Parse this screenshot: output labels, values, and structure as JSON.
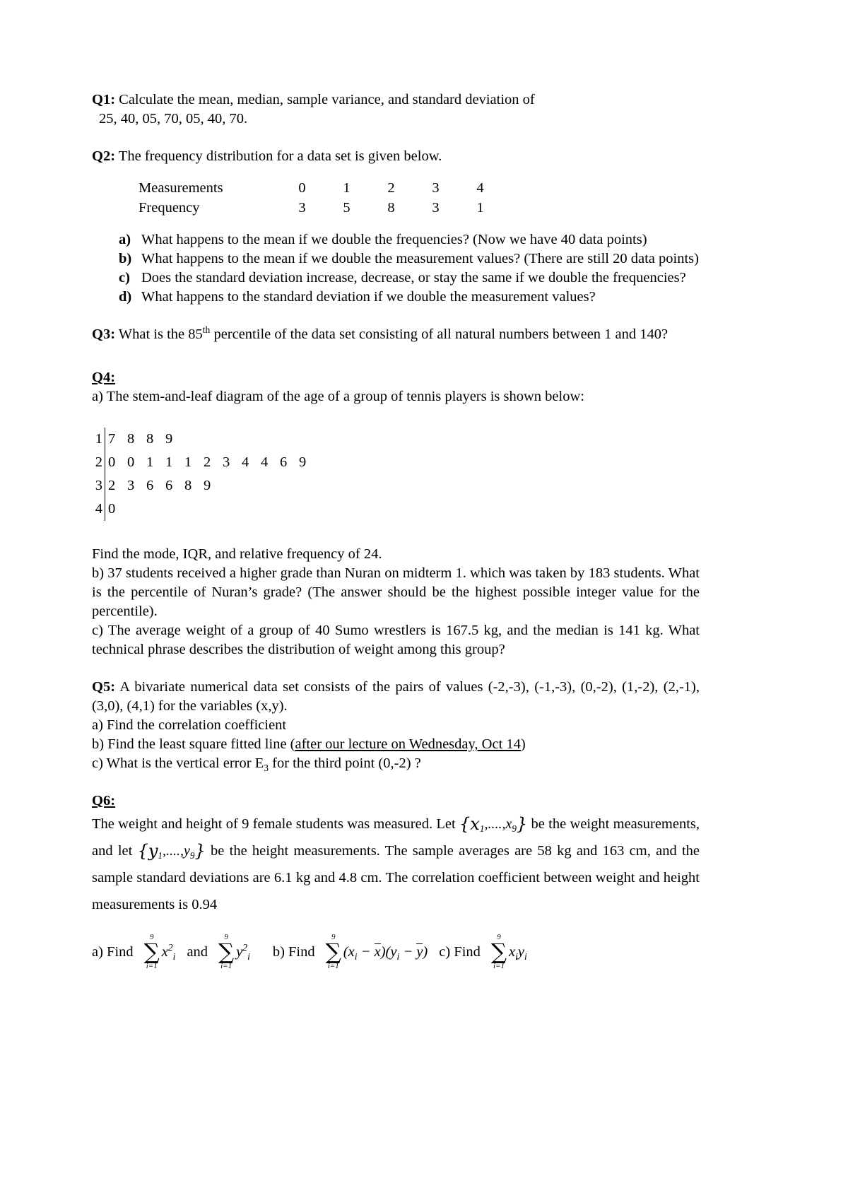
{
  "document": {
    "q1": {
      "label": "Q1:",
      "text": "Calculate the mean, median, sample variance, and standard deviation of",
      "data_line": "25, 40, 05, 70, 05, 40, 70."
    },
    "q2": {
      "label": "Q2:",
      "text": "The frequency distribution for a data set is given below.",
      "table": {
        "row_labels": [
          "Measurements",
          "Frequency"
        ],
        "measurements": [
          "0",
          "1",
          "2",
          "3",
          "4"
        ],
        "frequencies": [
          "3",
          "5",
          "8",
          "3",
          "1"
        ]
      },
      "items": [
        {
          "marker": "a)",
          "text": "What happens to the mean if we double the frequencies? (Now we have 40 data points)"
        },
        {
          "marker": "b)",
          "text": "What happens to the mean if we double the measurement values? (There are still 20 data points)"
        },
        {
          "marker": "c)",
          "text": "Does the standard deviation increase, decrease, or stay the same if we double the frequencies?"
        },
        {
          "marker": "d)",
          "text": "What happens to the standard deviation if we double the measurement values?"
        }
      ]
    },
    "q3": {
      "label": "Q3:",
      "text_before": "What is the 85",
      "superscript": "th",
      "text_after": " percentile of the data set consisting of all natural numbers between 1 and 140?"
    },
    "q4": {
      "label": "Q4:",
      "part_a": "a) The stem-and-leaf diagram of the age of a group of tennis players is shown below:",
      "stem_leaf": [
        {
          "stem": "1",
          "leaves": [
            "7",
            "8",
            "8",
            "9"
          ]
        },
        {
          "stem": "2",
          "leaves": [
            "0",
            "0",
            "1",
            "1",
            "1",
            "2",
            "3",
            "4",
            "4",
            "6",
            "9"
          ]
        },
        {
          "stem": "3",
          "leaves": [
            "2",
            "3",
            "6",
            "6",
            "8",
            "9"
          ]
        },
        {
          "stem": "4",
          "leaves": [
            "0"
          ]
        }
      ],
      "find_line": "Find the mode, IQR, and relative frequency of 24.",
      "part_b": "b) 37 students received a higher grade than Nuran on midterm 1. which was taken by 183 students. What is the percentile of Nuran’s grade? (The answer should be the highest possible integer value for the percentile).",
      "part_c": "c) The average weight of a group of 40 Sumo wrestlers is 167.5 kg, and the median is 141 kg. What technical phrase describes the distribution of weight among this group?"
    },
    "q5": {
      "label": "Q5:",
      "intro": "A bivariate numerical data set consists of the pairs of values (-2,-3), (-1,-3), (0,-2), (1,-2), (2,-1), (3,0), (4,1) for the variables (x,y).",
      "part_a": "a) Find the correlation coefficient",
      "part_b_before": "b) Find the least square fitted line (",
      "part_b_underlined": "after our lecture on Wednesday, Oct 14",
      "part_b_after": ")",
      "part_c_before": "c) What is the vertical error E",
      "part_c_subscript": "3",
      "part_c_after": " for the third point (0,-2) ?"
    },
    "q6": {
      "label": "Q6:",
      "text_1": "The weight and height of 9 female students was measured. Let",
      "set_x": "{x",
      "set_x_sub1": "1",
      "set_x_mid": ",....,x",
      "set_x_sub9": "9",
      "set_x_close": "}",
      "text_2": "be the weight measurements, and let",
      "set_y": "{y",
      "set_y_sub1": "1",
      "set_y_mid": ",....,y",
      "set_y_sub9": "9",
      "set_y_close": "}",
      "text_3": "be the height measurements. The sample averages are 58 kg and 163 cm, and the sample standard deviations are 6.1 kg and 4.8 cm. The correlation coefficient between weight and height measurements is 0.94",
      "formulas": {
        "a_label": "a) Find",
        "sum_upper": "9",
        "sum_lower": "i=1",
        "term_1": "x",
        "term_1_sup": "2",
        "term_1_sub": "i",
        "and_word": "and",
        "term_2": "y",
        "term_2_sup": "2",
        "term_2_sub": "i",
        "b_label": "b) Find",
        "term_3": "(x",
        "term_3_sub": "i",
        "term_3_mid": " − ",
        "term_3_xbar": "x",
        "term_3_mid2": ")(y",
        "term_3_sub2": "i",
        "term_3_mid3": " − ",
        "term_3_ybar": "y",
        "term_3_close": ")",
        "c_label": "c) Find",
        "term_4": "x",
        "term_4_sub": "i",
        "term_4b": "y",
        "term_4b_sub": "i"
      }
    }
  }
}
